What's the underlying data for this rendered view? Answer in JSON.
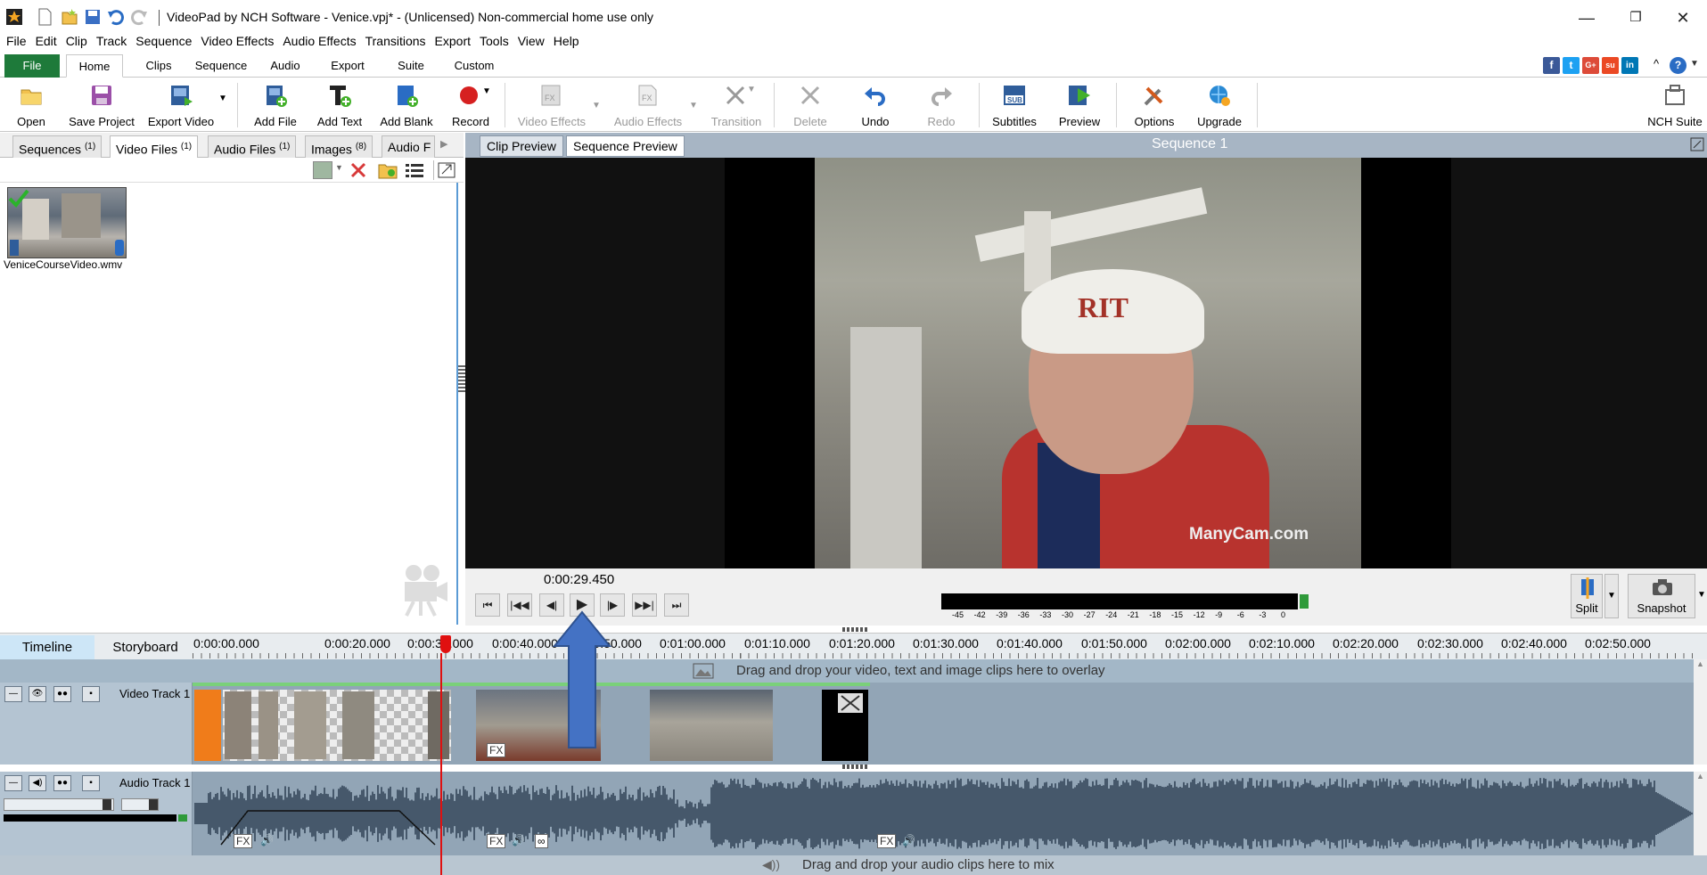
{
  "window": {
    "title": "VideoPad by NCH Software - Venice.vpj* - (Unlicensed) Non-commercial home use only",
    "minimize": "—",
    "restore": "❐",
    "close": "✕"
  },
  "menu": [
    "File",
    "Edit",
    "Clip",
    "Track",
    "Sequence",
    "Video Effects",
    "Audio Effects",
    "Transitions",
    "Export",
    "Tools",
    "View",
    "Help"
  ],
  "ribbon_tabs": [
    "File",
    "Home",
    "Clips",
    "Sequence",
    "Audio",
    "Export",
    "Suite",
    "Custom"
  ],
  "social": {
    "facebook": "f",
    "twitter": "t",
    "google": "G+",
    "stumble": "su",
    "linkedin": "in",
    "collapse": "^",
    "help": "?"
  },
  "toolbar": {
    "open": "Open",
    "save_project": "Save Project",
    "export_video": "Export Video",
    "add_file": "Add File",
    "add_text": "Add Text",
    "add_blank": "Add Blank",
    "record": "Record",
    "video_effects": "Video Effects",
    "audio_effects": "Audio Effects",
    "transition": "Transition",
    "delete": "Delete",
    "undo": "Undo",
    "redo": "Redo",
    "subtitles": "Subtitles",
    "preview": "Preview",
    "options": "Options",
    "upgrade": "Upgrade",
    "nch_suite": "NCH Suite"
  },
  "bin": {
    "tabs": [
      {
        "label": "Sequences",
        "count": "(1)"
      },
      {
        "label": "Video Files",
        "count": "(1)"
      },
      {
        "label": "Audio Files",
        "count": "(1)"
      },
      {
        "label": "Images",
        "count": "(8)"
      },
      {
        "label": "Audio F",
        "count": ""
      }
    ],
    "file_name": "VeniceCourseVideo.wmv"
  },
  "preview": {
    "clip_tab": "Clip Preview",
    "sequence_tab": "Sequence Preview",
    "sequence_name": "Sequence 1",
    "time": "0:00:29.450",
    "watermark": "ManyCam.com",
    "hat_text": "RIT",
    "meter_ticks": [
      "-45",
      "-42",
      "-39",
      "-36",
      "-33",
      "-30",
      "-27",
      "-24",
      "-21",
      "-18",
      "-15",
      "-12",
      "-9",
      "-6",
      "-3",
      "0"
    ],
    "split": "Split",
    "snapshot": "Snapshot"
  },
  "timeline": {
    "tab_timeline": "Timeline",
    "tab_storyboard": "Storyboard",
    "ticks": [
      "0:00:00.000",
      "0:00:20.000",
      "0:00:30.000",
      "0:00:40.000",
      "0:00:50.000",
      "0:01:00.000",
      "0:01:10.000",
      "0:01:20.000",
      "0:01:30.000",
      "0:01:40.000",
      "0:01:50.000",
      "0:02:00.000",
      "0:02:10.000",
      "0:02:20.000",
      "0:02:30.000",
      "0:02:40.000",
      "0:02:50.000"
    ],
    "overlay_hint": "Drag and drop your video, text and image clips here to overlay",
    "video_track": "Video Track 1",
    "audio_track": "Audio Track 1",
    "audio_hint": "Drag and drop your audio clips here to mix",
    "fx": "FX"
  }
}
